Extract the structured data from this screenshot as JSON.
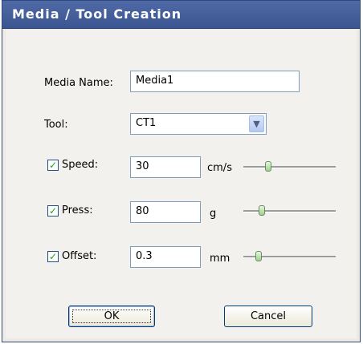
{
  "window": {
    "title": "Media / Tool Creation"
  },
  "form": {
    "media_name": {
      "label": "Media Name:",
      "value": "Media1"
    },
    "tool": {
      "label": "Tool:",
      "value": "CT1",
      "arrow": "chevron-down-icon"
    },
    "speed": {
      "label": "Speed:",
      "checked": true,
      "value": "30",
      "unit": "cm/s",
      "slider_level": 0.25
    },
    "press": {
      "label": "Press:",
      "checked": true,
      "value": "80",
      "unit": "g",
      "slider_level": 0.18
    },
    "offset": {
      "label": "Offset:",
      "checked": true,
      "value": "0.3",
      "unit": "mm",
      "slider_level": 0.14
    }
  },
  "buttons": {
    "ok": "OK",
    "cancel": "Cancel"
  },
  "colors": {
    "title_bar": "#3b5590",
    "check_mark": "#21a121",
    "slider_thumb": "#9bd08a"
  }
}
